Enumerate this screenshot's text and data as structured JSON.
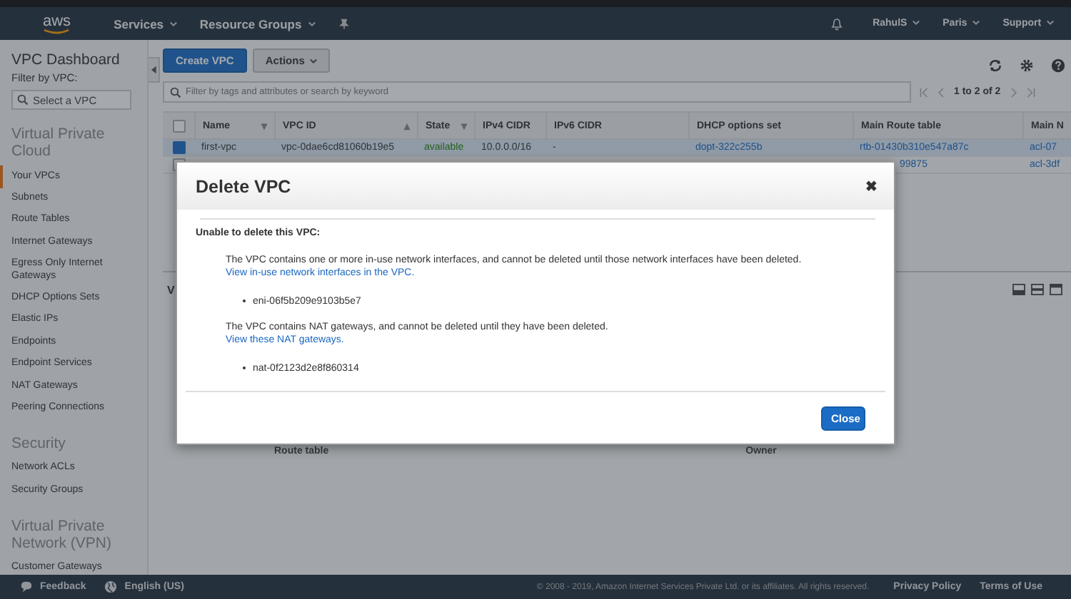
{
  "nav": {
    "logo": "aws",
    "menus": [
      "Services",
      "Resource Groups"
    ],
    "user": "RahulS",
    "region": "Paris",
    "support": "Support"
  },
  "sidebar": {
    "title": "VPC Dashboard",
    "filter_label": "Filter by VPC:",
    "filter_placeholder": "Select a VPC",
    "sections": [
      {
        "title": "Virtual Private Cloud",
        "items": [
          {
            "label": "Your VPCs",
            "selected": true
          },
          {
            "label": "Subnets",
            "selected": false
          },
          {
            "label": "Route Tables",
            "selected": false
          },
          {
            "label": "Internet Gateways",
            "selected": false
          },
          {
            "label": "Egress Only Internet Gateways",
            "selected": false
          },
          {
            "label": "DHCP Options Sets",
            "selected": false
          },
          {
            "label": "Elastic IPs",
            "selected": false
          },
          {
            "label": "Endpoints",
            "selected": false
          },
          {
            "label": "Endpoint Services",
            "selected": false
          },
          {
            "label": "NAT Gateways",
            "selected": false
          },
          {
            "label": "Peering Connections",
            "selected": false
          }
        ]
      },
      {
        "title": "Security",
        "items": [
          {
            "label": "Network ACLs",
            "selected": false
          },
          {
            "label": "Security Groups",
            "selected": false
          }
        ]
      },
      {
        "title": "Virtual Private Network (VPN)",
        "items": [
          {
            "label": "Customer Gateways",
            "selected": false
          }
        ]
      }
    ]
  },
  "toolbar": {
    "create": "Create VPC",
    "actions": "Actions"
  },
  "search": {
    "placeholder": "Filter by tags and attributes or search by keyword"
  },
  "pagination": "1 to 2 of 2",
  "table": {
    "all_selected": false,
    "columns": [
      {
        "label": "Name",
        "sort_indicator": "▾"
      },
      {
        "label": "VPC ID",
        "sort_indicator": "▴"
      },
      {
        "label": "State",
        "sort_indicator": "▾"
      },
      {
        "label": "IPv4 CIDR"
      },
      {
        "label": "IPv6 CIDR"
      },
      {
        "label": "DHCP options set"
      },
      {
        "label": "Main Route table"
      },
      {
        "label": "Main N"
      }
    ],
    "rows": [
      {
        "selected": true,
        "cells": {
          "name": "first-vpc",
          "vpc_id": "vpc-0dae6cd81060b19e5",
          "state": "available",
          "ipv4": "10.0.0.0/16",
          "ipv6": "-",
          "dhcp": "dopt-322c255b",
          "route_table": "rtb-01430b310e547a87c",
          "main_acl": "acl-07"
        }
      },
      {
        "selected": false,
        "cells": {
          "route_table": "99875",
          "main_acl": "acl-3df"
        }
      }
    ]
  },
  "details": {
    "tab": "V",
    "route_label": "Route table",
    "owner_label": "Owner"
  },
  "modal": {
    "title": "Delete VPC",
    "close_icon": "✖",
    "heading": "Unable to delete this VPC:",
    "blocks": [
      {
        "text": "The VPC contains one or more in-use network interfaces, and cannot be deleted until those network interfaces have been deleted.",
        "link": "View in-use network interfaces in the VPC.",
        "items": [
          "eni-06f5b209e9103b5e7"
        ]
      },
      {
        "text": "The VPC contains NAT gateways, and cannot be deleted until they have been deleted.",
        "link": "View these NAT gateways.",
        "items": [
          "nat-0f2123d2e8f860314"
        ]
      }
    ],
    "button": "Close"
  },
  "footer": {
    "feedback": "Feedback",
    "language": "English (US)",
    "copyright": "© 2008 - 2019, Amazon Internet Services Private Ltd. or its affiliates. All rights reserved.",
    "links": [
      "Privacy Policy",
      "Terms of Use"
    ]
  }
}
